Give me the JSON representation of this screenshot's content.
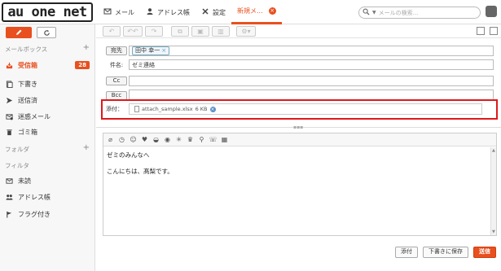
{
  "brand": {
    "logo_text": "au one net"
  },
  "nav": {
    "items": [
      {
        "label": "メール",
        "icon": "mail-icon"
      },
      {
        "label": "アドレス帳",
        "icon": "person-icon"
      },
      {
        "label": "設定",
        "icon": "tools-icon"
      },
      {
        "label": "新規メ...",
        "icon": ""
      }
    ],
    "active_index": 3
  },
  "search": {
    "placeholder": "メールの検索..."
  },
  "sidebar": {
    "mailbox_header": "メールボックス",
    "folders": [
      {
        "label": "受信箱",
        "icon": "inbox-icon",
        "count": "28",
        "active": true
      },
      {
        "label": "下書き",
        "icon": "draft-icon"
      },
      {
        "label": "送信済",
        "icon": "sent-icon"
      },
      {
        "label": "迷惑メール",
        "icon": "spam-icon"
      },
      {
        "label": "ゴミ箱",
        "icon": "trash-icon"
      }
    ],
    "folder_header": "フォルダ",
    "filter_header": "フィルタ",
    "filters": [
      {
        "label": "未読",
        "icon": "unread-icon"
      },
      {
        "label": "アドレス帳",
        "icon": "people-icon"
      },
      {
        "label": "フラグ付き",
        "icon": "flag-icon"
      }
    ]
  },
  "compose": {
    "to_button": "宛先",
    "to_recipient": "田中 幸一",
    "subject_label": "件名:",
    "subject_value": "ゼミ連絡",
    "cc_button": "Cc",
    "bcc_button": "Bcc",
    "attach_label": "添付：",
    "attachment_name": "attach_sample.xlsx",
    "attachment_size": "6 KB",
    "body_lines": [
      "ゼミのみんなへ",
      "",
      "こんにちは、髙梨です。"
    ]
  },
  "actions": {
    "attach": "添付",
    "save_draft": "下書きに保存",
    "send": "送信"
  },
  "colors": {
    "accent": "#e8501f",
    "highlight": "#e0181b"
  }
}
